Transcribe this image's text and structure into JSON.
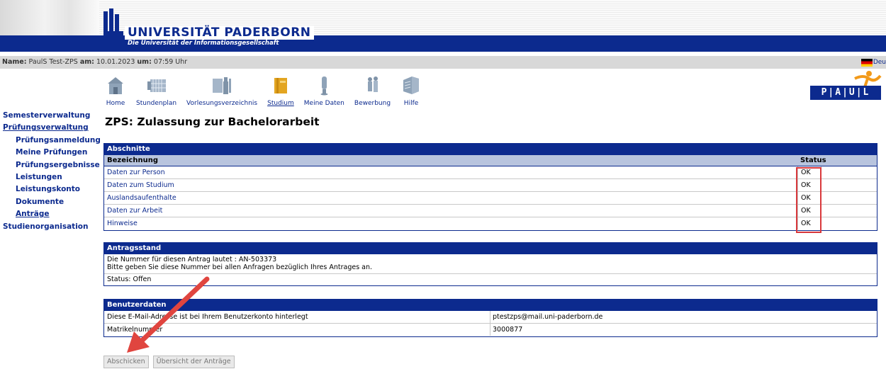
{
  "header": {
    "university": "UNIVERSITÄT PADERBORN",
    "subtitle": "Die Universität der Informationsgesellschaft",
    "logo_icon": "university-logo-icon",
    "brand_color": "#0c2a8e"
  },
  "infobar": {
    "name_label": "Name:",
    "name_value": "PaulS Test-ZPS",
    "am_label": "am:",
    "date": "10.01.2023",
    "um_label": "um:",
    "time": "07:59 Uhr",
    "language": "Deu"
  },
  "topnav": [
    {
      "label": "Home",
      "icon": "home-icon",
      "active": false
    },
    {
      "label": "Stundenplan",
      "icon": "timetable-icon",
      "active": false
    },
    {
      "label": "Vorlesungsverzeichnis",
      "icon": "lecture-directory-icon",
      "active": false
    },
    {
      "label": "Studium",
      "icon": "studies-icon",
      "active": true
    },
    {
      "label": "Meine Daten",
      "icon": "my-data-icon",
      "active": false
    },
    {
      "label": "Bewerbung",
      "icon": "application-icon",
      "active": false
    },
    {
      "label": "Hilfe",
      "icon": "help-icon",
      "active": false
    }
  ],
  "paul_logo": {
    "text": "P|A|U|L"
  },
  "sidenav": [
    {
      "label": "Semesterverwaltung",
      "level": 1,
      "active": false
    },
    {
      "label": "Prüfungsverwaltung",
      "level": 1,
      "active": true
    },
    {
      "label": "Prüfungsanmeldung",
      "level": 2,
      "active": false
    },
    {
      "label": "Meine Prüfungen",
      "level": 2,
      "active": false
    },
    {
      "label": "Prüfungsergebnisse",
      "level": 2,
      "active": false
    },
    {
      "label": "Leistungen",
      "level": 2,
      "active": false
    },
    {
      "label": "Leistungskonto",
      "level": 2,
      "active": false
    },
    {
      "label": "Dokumente",
      "level": 2,
      "active": false
    },
    {
      "label": "Anträge",
      "level": 2,
      "active": true
    },
    {
      "label": "Studienorganisation",
      "level": 1,
      "active": false
    }
  ],
  "main": {
    "title": "ZPS: Zulassung zur Bachelorarbeit",
    "abschnitte": {
      "heading": "Abschnitte",
      "col_name": "Bezeichnung",
      "col_status": "Status",
      "rows": [
        {
          "name": "Daten zur Person",
          "status": "OK"
        },
        {
          "name": "Daten zum Studium",
          "status": "OK"
        },
        {
          "name": "Auslandsaufenthalte",
          "status": "OK"
        },
        {
          "name": "Daten zur Arbeit",
          "status": "OK"
        },
        {
          "name": "Hinweise",
          "status": "OK"
        }
      ]
    },
    "antragsstand": {
      "heading": "Antragsstand",
      "line1": "Die Nummer für diesen Antrag lautet : AN-503373",
      "line2": "Bitte geben Sie diese Nummer bei allen Anfragen bezüglich Ihres Antrages an.",
      "status": "Status: Offen"
    },
    "benutzerdaten": {
      "heading": "Benutzerdaten",
      "rows": [
        {
          "key": "Diese E-Mail-Adresse ist bei Ihrem Benutzerkonto hinterlegt",
          "value": "ptestzps@mail.uni-paderborn.de"
        },
        {
          "key": "Matrikelnummer",
          "value": "3000877"
        }
      ]
    },
    "buttons": {
      "submit": "Abschicken",
      "overview": "Übersicht der Anträge"
    }
  },
  "annotation": {
    "highlight_color": "#d9383c"
  }
}
